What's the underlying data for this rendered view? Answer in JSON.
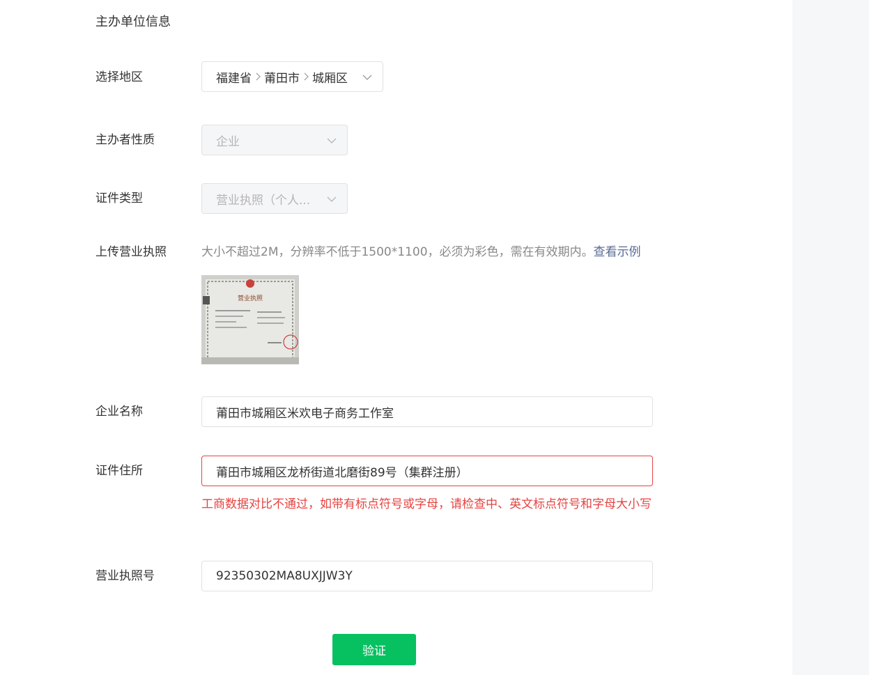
{
  "section": {
    "title": "主办单位信息"
  },
  "region": {
    "label": "选择地区",
    "province": "福建省",
    "city": "莆田市",
    "district": "城厢区"
  },
  "nature": {
    "label": "主办者性质",
    "value": "企业"
  },
  "cert_type": {
    "label": "证件类型",
    "value": "营业执照（个人..."
  },
  "upload": {
    "label": "上传营业执照",
    "hint": "大小不超过2M，分辨率不低于1500*1100，必须为彩色，需在有效期内。",
    "example_link": "查看示例",
    "thumb_title": "营业执照"
  },
  "company_name": {
    "label": "企业名称",
    "value": "莆田市城厢区米欢电子商务工作室"
  },
  "address": {
    "label": "证件住所",
    "value": "莆田市城厢区龙桥街道北磨街89号（集群注册）",
    "error": "工商数据对比不通过，如带有标点符号或字母，请检查中、英文标点符号和字母大小写"
  },
  "license_no": {
    "label": "营业执照号",
    "value": "92350302MA8UXJJW3Y"
  },
  "verify_button": "验证",
  "colors": {
    "primary": "#07c160",
    "error": "#e64340",
    "link": "#576b95"
  }
}
